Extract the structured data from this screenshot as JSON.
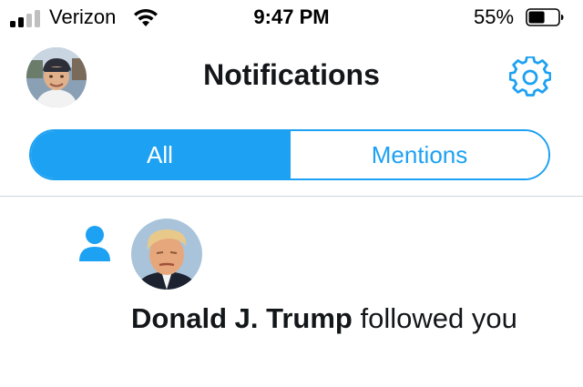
{
  "status_bar": {
    "carrier": "Verizon",
    "time": "9:47 PM",
    "battery_percent": "55%",
    "battery_level": 0.55,
    "signal_bars_filled": 2,
    "signal_bars_total": 4
  },
  "header": {
    "title": "Notifications",
    "profile_icon": "user-avatar-icon",
    "settings_icon": "gear-icon"
  },
  "tabs": [
    {
      "label": "All",
      "active": true
    },
    {
      "label": "Mentions",
      "active": false
    }
  ],
  "notifications": [
    {
      "type_icon": "person-icon",
      "user_name": "Donald J. Trump",
      "action_text": " followed you"
    }
  ],
  "colors": {
    "accent": "#1da1f2",
    "text": "#14171a",
    "divider": "#ccd6dd"
  }
}
